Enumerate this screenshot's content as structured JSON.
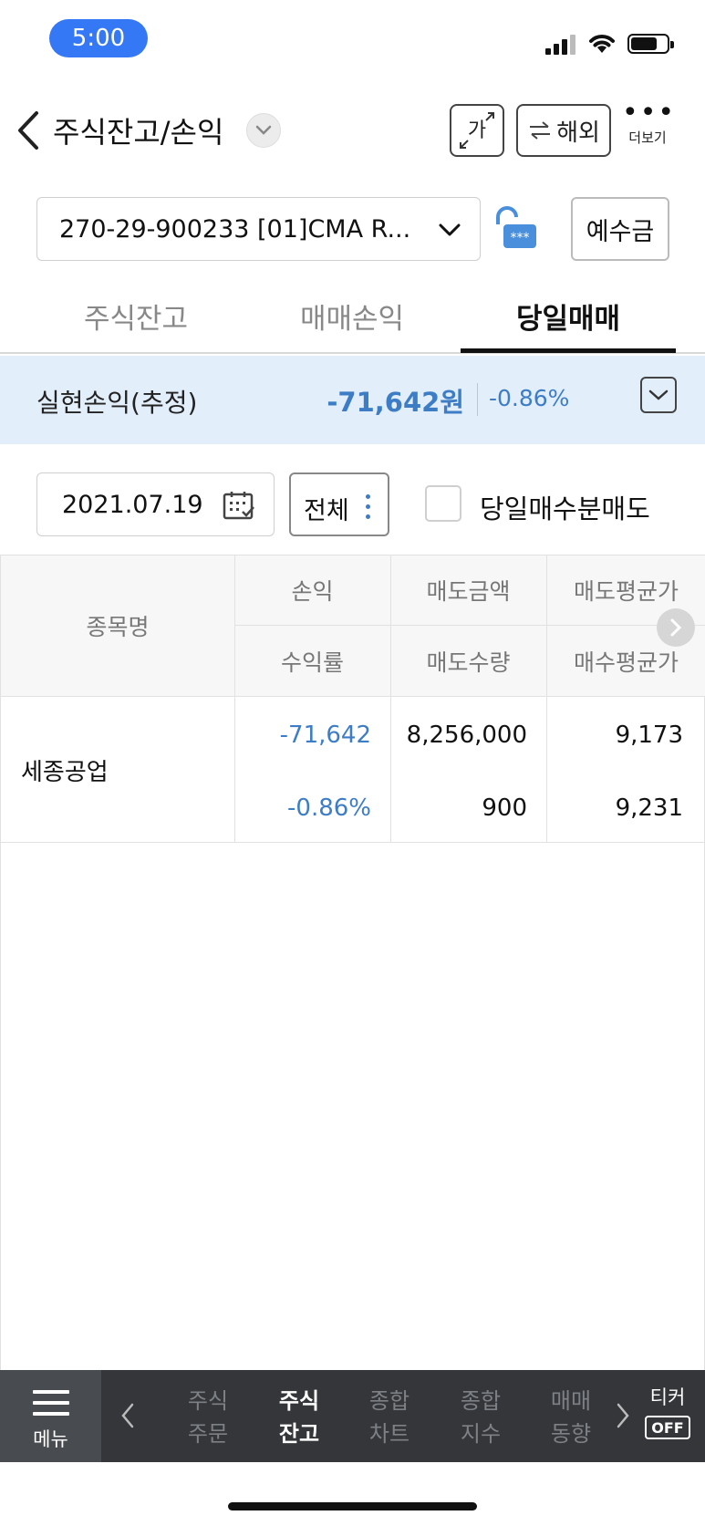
{
  "status_bar": {
    "time": "5:00"
  },
  "header": {
    "title": "주식잔고/손익",
    "font_button_label": "가",
    "overseas_button_label": "해외",
    "more_label": "더보기"
  },
  "account": {
    "selected": "270-29-900233 [01]CMA R...",
    "deposit_button_label": "예수금"
  },
  "tabs": [
    {
      "label": "주식잔고",
      "active": false
    },
    {
      "label": "매매손익",
      "active": false
    },
    {
      "label": "당일매매",
      "active": true
    }
  ],
  "summary": {
    "label": "실현손익(추정)",
    "amount": "-71,642원",
    "rate": "-0.86%"
  },
  "filter": {
    "date": "2021.07.19",
    "scope_label": "전체",
    "checkbox_label": "당일매수분매도"
  },
  "table": {
    "headers": {
      "name": "종목명",
      "col1_top": "손익",
      "col1_bottom": "수익률",
      "col2_top": "매도금액",
      "col2_bottom": "매도수량",
      "col3_top": "매도평균가",
      "col3_bottom": "매수평균가"
    },
    "rows": [
      {
        "name": "세종공업",
        "profit": "-71,642",
        "rate": "-0.86%",
        "sell_amount": "8,256,000",
        "sell_qty": "900",
        "sell_avg": "9,173",
        "buy_avg": "9,231"
      }
    ]
  },
  "bottom_nav": {
    "menu_label": "메뉴",
    "items": [
      {
        "line1": "주식",
        "line2": "주문",
        "active": false
      },
      {
        "line1": "주식",
        "line2": "잔고",
        "active": true
      },
      {
        "line1": "종합",
        "line2": "차트",
        "active": false
      },
      {
        "line1": "종합",
        "line2": "지수",
        "active": false
      },
      {
        "line1": "매매",
        "line2": "동향",
        "active": false
      }
    ],
    "ticker_label": "티커",
    "ticker_state": "OFF"
  },
  "colors": {
    "accent_blue": "#3d7dc6",
    "summary_bg": "#e3eefb",
    "nav_bg": "#34363a",
    "status_pill": "#3478f6"
  }
}
